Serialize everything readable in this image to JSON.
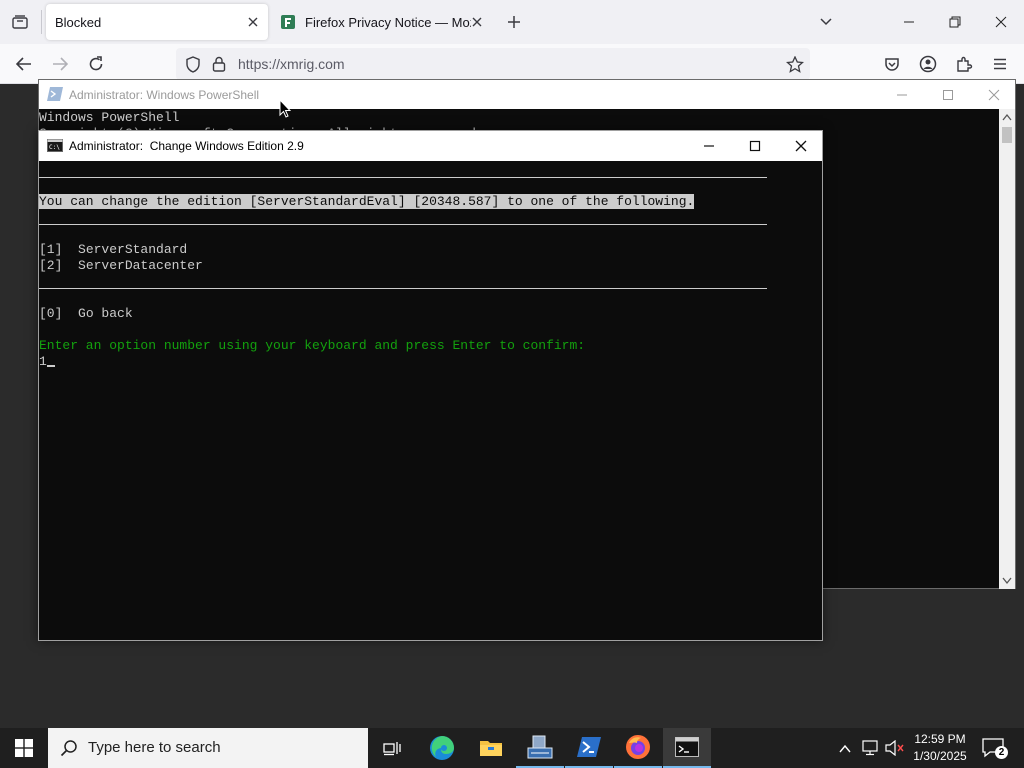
{
  "browser": {
    "tabs": [
      {
        "label": "Blocked",
        "active": true
      },
      {
        "label": "Firefox Privacy Notice — Mozill",
        "active": false
      }
    ],
    "url": "https://xmrig.com",
    "icons": {
      "tab_list": "tab-list-icon",
      "new_tab": "plus-icon",
      "back": "back-arrow-icon",
      "forward": "forward-arrow-icon",
      "reload": "reload-icon",
      "shield": "shield-icon",
      "lock": "lock-icon",
      "bookmark": "star-icon",
      "pocket": "pocket-icon",
      "account": "account-icon",
      "extensions": "puzzle-icon",
      "menu": "hamburger-menu-icon"
    }
  },
  "powershell": {
    "title": "Administrator: Windows PowerShell",
    "lines": [
      "Windows PowerShell",
      "Copyright (C) Microsoft Corporation. All rights reserved."
    ]
  },
  "cmd": {
    "title_prefix": "Administrator:",
    "title_name": "Change Windows Edition 2.9",
    "header_line": "You can change the edition [ServerStandardEval] [20348.587] to one of the following.",
    "options": [
      {
        "key": "[1]",
        "label": "ServerStandard"
      },
      {
        "key": "[2]",
        "label": "ServerDatacenter"
      }
    ],
    "back_option": {
      "key": "[0]",
      "label": "Go back"
    },
    "prompt": "Enter an option number using your keyboard and press Enter to confirm:",
    "input_value": "1"
  },
  "taskbar": {
    "search_placeholder": "Type here to search",
    "time": "12:59 PM",
    "date": "1/30/2025",
    "notification_count": "2",
    "apps": [
      "task-view-icon",
      "edge-icon",
      "file-explorer-icon",
      "server-manager-icon",
      "powershell-icon",
      "firefox-icon",
      "cmd-icon"
    ]
  },
  "colors": {
    "accent_green": "#13a10e",
    "console_bg": "#0c0c0c",
    "console_fg": "#cccccc"
  }
}
